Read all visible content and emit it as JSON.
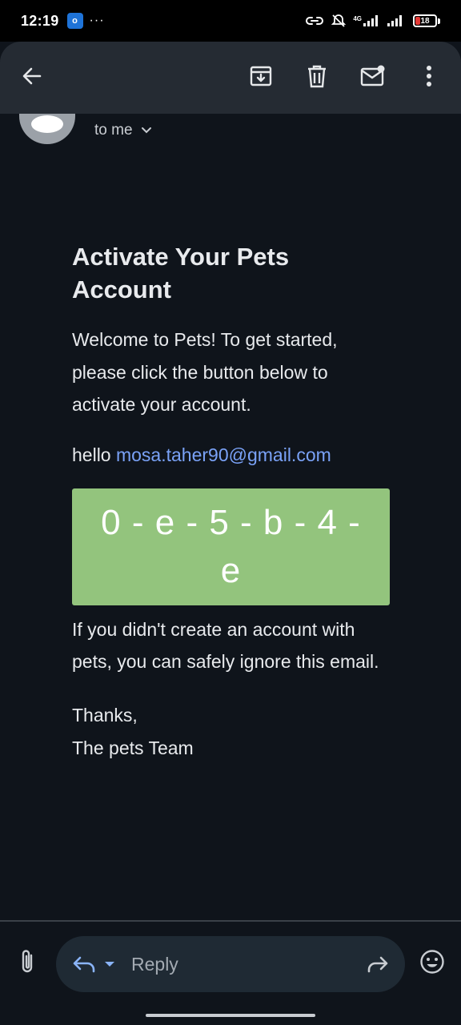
{
  "status_bar": {
    "time": "12:19",
    "app_badge": "o",
    "more": "···",
    "network": "4G",
    "battery": "18"
  },
  "toolbar": {
    "back_icon": "arrow-back-icon",
    "archive_icon": "archive-icon",
    "delete_icon": "trash-icon",
    "mark_unread_icon": "mark-unread-icon",
    "more_icon": "more-vert-icon"
  },
  "sender": {
    "to": "to me"
  },
  "email": {
    "title": "Activate Your Pets Account",
    "intro": "Welcome to Pets! To get started, please click the button below to activate your account.",
    "hello_prefix": "hello ",
    "email_address": "mosa.taher90@gmail.com",
    "code": "0 - e - 5 - b - 4 - e",
    "ignore_note": "If you didn't create an account with pets, you can safely ignore this email.",
    "thanks": "Thanks,",
    "signature": "The pets Team"
  },
  "colors": {
    "background": "#0f141b",
    "app_bar": "#252b33",
    "code_box": "#93c47d",
    "link": "#7aa2f7",
    "reply_pill": "#1f2a34"
  },
  "reply_bar": {
    "reply_label": "Reply",
    "attach_icon": "paperclip-icon",
    "reply_icon": "reply-icon",
    "forward_icon": "forward-icon",
    "emoji_icon": "emoji-icon"
  }
}
